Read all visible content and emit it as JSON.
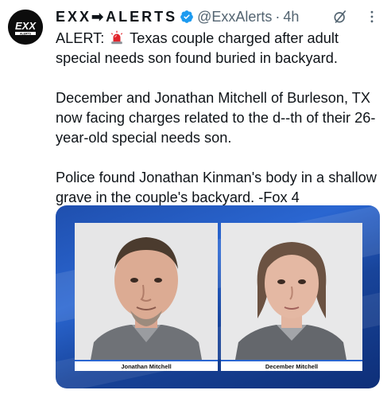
{
  "account": {
    "display_name": "EXX➡ALERTS",
    "handle": "@ExxAlerts",
    "separator": "·",
    "time": "4h",
    "avatar_text": "EXX",
    "avatar_subtext": "ALERTS"
  },
  "tweet": {
    "line1_prefix": "ALERT:",
    "line1_rest": "Texas couple charged after adult special needs son found buried in backyard.",
    "paragraph2": "December and Jonathan Mitchell of Burleson, TX now facing charges related to the d--th of their 26-year-old special needs son.",
    "paragraph3": "Police found Jonathan Kinman's body in a shallow grave in the couple's backyard. -Fox 4"
  },
  "media": {
    "left_caption": "Jonathan Mitchell",
    "right_caption": "December Mitchell"
  },
  "colors": {
    "verified": "#1d9bf0",
    "text": "#0f1419",
    "secondary": "#536471",
    "media_background": "#2a66d1"
  },
  "icons": {
    "verified": "verified-badge-icon",
    "grok": "grok-icon",
    "more": "more-options-icon",
    "siren": "rotating-light-icon"
  }
}
